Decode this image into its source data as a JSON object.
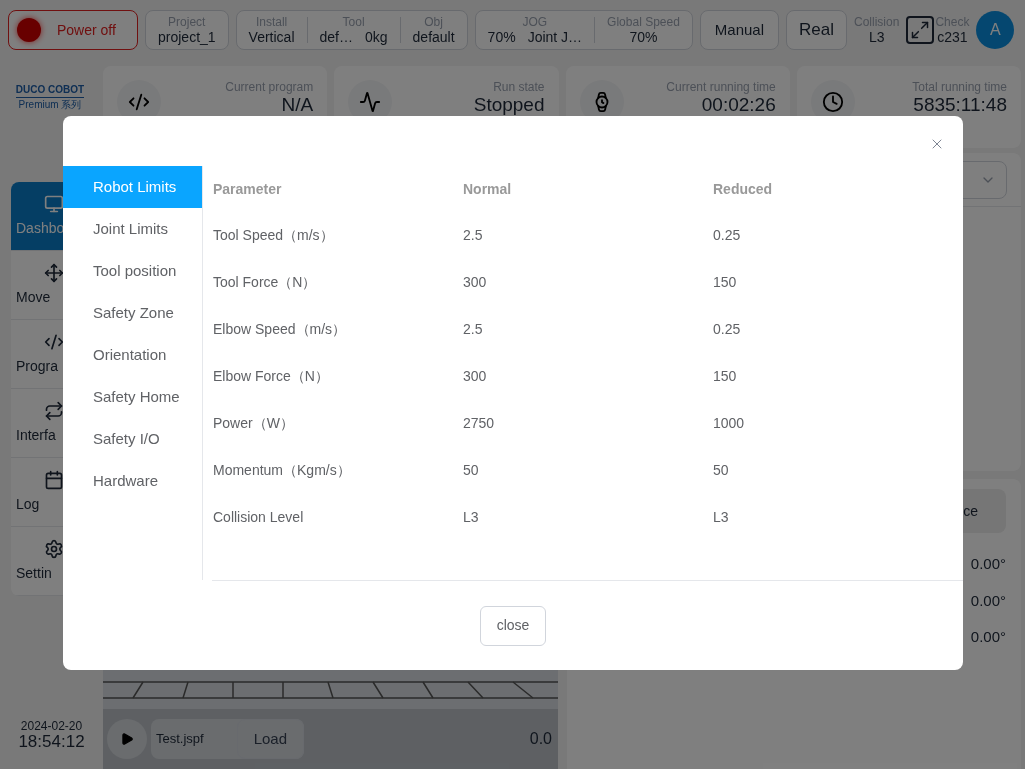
{
  "top_bar": {
    "power_button": {
      "label": "Power off"
    },
    "project": {
      "label": "Project",
      "values": [
        "project_1"
      ]
    },
    "install_group": [
      {
        "label": "Install",
        "values": [
          "Vertical"
        ]
      },
      {
        "label": "Tool",
        "values": [
          "def…",
          "0kg"
        ]
      },
      {
        "label": "Obj",
        "values": [
          "default"
        ]
      }
    ],
    "jog_group": [
      {
        "label": "JOG",
        "values": [
          "70%",
          "Joint J…"
        ]
      },
      {
        "label": "Global Speed",
        "values": [
          "70%"
        ]
      }
    ],
    "mode_button": "Manual",
    "real_button": "Real",
    "collision": {
      "label": "Collision",
      "value": "L3"
    },
    "check": {
      "label": "Check",
      "value": "c231"
    },
    "avatar": "A"
  },
  "logo": {
    "brand": "DUCO COBOT",
    "series": "Premium 系列"
  },
  "sidebar": [
    {
      "kind": "monitor",
      "label": "Dashbo",
      "selected": true
    },
    {
      "kind": "move",
      "label": "Move",
      "selected": false
    },
    {
      "kind": "code",
      "label": "Progra",
      "selected": false
    },
    {
      "kind": "repeat",
      "label": "Interfa",
      "selected": false
    },
    {
      "kind": "calendar",
      "label": "Log",
      "selected": false
    },
    {
      "kind": "settings",
      "label": "Settin",
      "selected": false
    }
  ],
  "stats": [
    {
      "kind": "code",
      "label": "Current program",
      "value": "N/A"
    },
    {
      "kind": "pulse",
      "label": "Run state",
      "value": "Stopped"
    },
    {
      "kind": "watch",
      "label": "Current running time",
      "value": "00:02:26"
    },
    {
      "kind": "clock",
      "label": "Total running time",
      "value": "5835:11:48"
    }
  ],
  "right_panel": {
    "button": "ce",
    "joint_readings": [
      "0.00°",
      "0.00°",
      "0.00°"
    ]
  },
  "bottom": {
    "date": "2024-02-20",
    "time": "18:54:12",
    "program_file": "Test.jspf",
    "load_button": "Load",
    "reading": "0.0"
  },
  "dialog": {
    "nav": [
      {
        "label": "Robot Limits",
        "selected": true
      },
      {
        "label": "Joint Limits",
        "selected": false
      },
      {
        "label": "Tool position",
        "selected": false
      },
      {
        "label": "Safety Zone",
        "selected": false
      },
      {
        "label": "Orientation",
        "selected": false
      },
      {
        "label": "Safety Home",
        "selected": false
      },
      {
        "label": "Safety I/O",
        "selected": false
      },
      {
        "label": "Hardware",
        "selected": false
      }
    ],
    "columns": [
      "Parameter",
      "Normal",
      "Reduced"
    ],
    "rows": [
      [
        "Tool Speed（m/s）",
        "2.5",
        "0.25"
      ],
      [
        "Tool Force（N）",
        "300",
        "150"
      ],
      [
        "Elbow Speed（m/s）",
        "2.5",
        "0.25"
      ],
      [
        "Elbow Force（N）",
        "300",
        "150"
      ],
      [
        "Power（W）",
        "2750",
        "1000"
      ],
      [
        "Momentum（Kgm/s）",
        "50",
        "50"
      ],
      [
        "Collision Level",
        "L3",
        "L3"
      ]
    ],
    "close_button": "close"
  }
}
